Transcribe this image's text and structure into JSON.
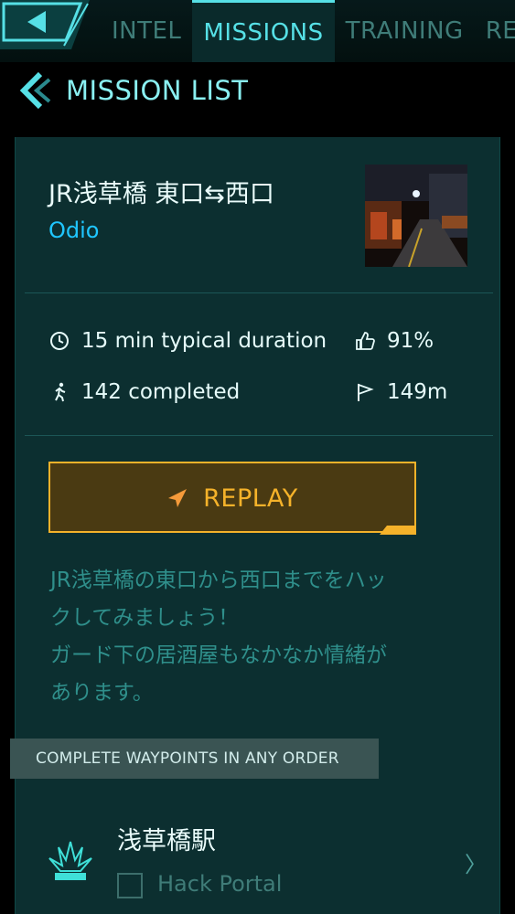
{
  "nav": {
    "tabs": [
      {
        "label": "INTEL"
      },
      {
        "label": "MISSIONS"
      },
      {
        "label": "TRAINING"
      },
      {
        "label": "REC"
      }
    ],
    "active_tab": "MISSIONS"
  },
  "header": {
    "title": "MISSION LIST"
  },
  "mission": {
    "title": "JR浅草橋 東口⇆西口",
    "author": "Odio",
    "duration": "15 min typical duration",
    "rating": "91%",
    "completed": "142 completed",
    "distance": "149m",
    "replay_label": "REPLAY",
    "description_lines": [
      "JR浅草橋の東口から西口までをハッ",
      "クしてみましょう！",
      "ガード下の居酒屋もなかなか情緒が",
      "あります。"
    ]
  },
  "waypoints": {
    "banner": "COMPLETE WAYPOINTS IN ANY ORDER",
    "items": [
      {
        "name": "浅草橋駅",
        "task": "Hack Portal",
        "done": false
      }
    ]
  },
  "colors": {
    "accent": "#56e0e6",
    "author": "#1fc6ff",
    "replay": "#f5b22a",
    "card": "#0c2f30"
  },
  "icons": {
    "back": "back-arrow-icon",
    "duration": "clock-icon",
    "rating": "thumbs-up-icon",
    "completed": "walker-icon",
    "distance": "flag-icon",
    "replay": "paper-plane-icon",
    "portal": "portal-icon",
    "open": "chevron-right-icon"
  }
}
